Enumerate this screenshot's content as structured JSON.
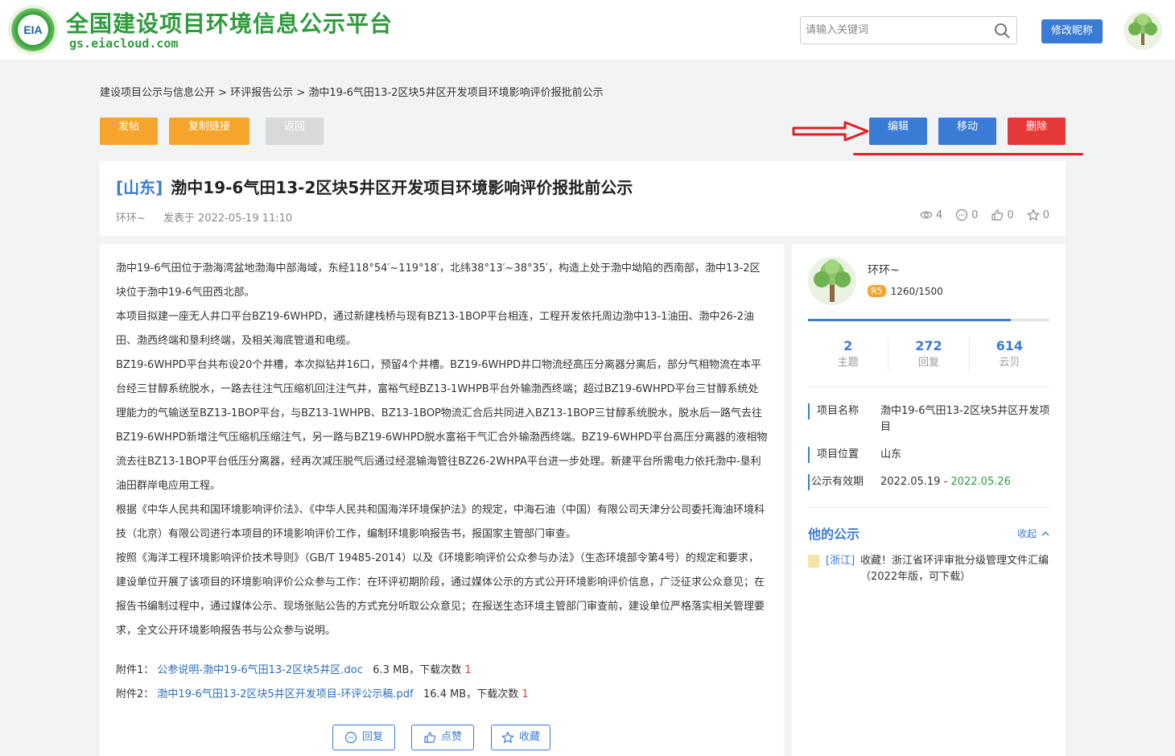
{
  "header": {
    "logo_text": "EIA",
    "site_title": "全国建设项目环境信息公示平台",
    "site_url": "gs.eiacloud.com",
    "search_placeholder": "请输入关键词",
    "nick_button": "修改昵称"
  },
  "breadcrumb": {
    "items": [
      "建设项目公示与信息公开",
      "环评报告公示",
      "渤中19-6气田13-2区块5井区开发项目环境影响评价报批前公示"
    ],
    "separator": ">"
  },
  "toolbar": {
    "post": "发帖",
    "copy_link": "复制链接",
    "back": "返回",
    "edit": "编辑",
    "move": "移动",
    "delete": "删除"
  },
  "post": {
    "region": "[山东]",
    "title": "渤中19-6气田13-2区块5井区开发项目环境影响评价报批前公示",
    "author": "环环~",
    "published": "发表于 2022-05-19 11:10",
    "views": "4",
    "comments": "0",
    "likes": "0",
    "favorites": "0"
  },
  "content": {
    "paragraphs": [
      "渤中19-6气田位于渤海湾盆地渤海中部海域，东经118°54′~119°18′，北纬38°13′~38°35′，构造上处于渤中坳陷的西南部，渤中13-2区块位于渤中19-6气田西北部。",
      "本项目拟建一座无人井口平台BZ19-6WHPD，通过新建栈桥与现有BZ13-1BOP平台相连，工程开发依托周边渤中13-1油田、渤中26-2油田、渤西终端和垦利终端，及相关海底管道和电缆。",
      "BZ19-6WHPD平台共布设20个井槽，本次拟钻井16口，预留4个井槽。BZ19-6WHPD井口物流经高压分离器分离后，部分气相物流在本平台经三甘醇系统脱水，一路去往注气压缩机回注注气井，富裕气经BZ13-1WHPB平台外输渤西终端；超过BZ19-6WHPD平台三甘醇系统处理能力的气输送至BZ13-1BOP平台，与BZ13-1WHPB、BZ13-1BOP物流汇合后共同进入BZ13-1BOP三甘醇系统脱水，脱水后一路气去往BZ19-6WHPD新增注气压缩机压缩注气，另一路与BZ19-6WHPD脱水富裕干气汇合外输渤西终端。BZ19-6WHPD平台高压分离器的液相物流去往BZ13-1BOP平台低压分离器，经再次减压脱气后通过经混输海管往BZ26-2WHPA平台进一步处理。新建平台所需电力依托渤中-垦利油田群岸电应用工程。",
      "根据《中华人民共和国环境影响评价法》、《中华人民共和国海洋环境保护法》的规定，中海石油（中国）有限公司天津分公司委托海油环境科技（北京）有限公司进行本项目的环境影响评价工作，编制环境影响报告书，报国家主管部门审查。",
      "按照《海洋工程环境影响评价技术导则》（GB/T 19485-2014）以及《环境影响评价公众参与办法》（生态环境部令第4号）的规定和要求，建设单位开展了该项目的环境影响评价公众参与工作：在环评初期阶段，通过媒体公示的方式公开环境影响评价信息，广泛征求公众意见；在报告书编制过程中，通过媒体公示、现场张贴公告的方式充分听取公众意见；在报送生态环境主管部门审查前，建设单位严格落实相关管理要求，全文公开环境影响报告书与公众参与说明。"
    ],
    "attachments": [
      {
        "label": "附件1：",
        "name": "公参说明-渤中19-6气田13-2区块5井区.doc",
        "size": "6.3 MB，下载次数",
        "downloads": "1"
      },
      {
        "label": "附件2：",
        "name": "渤中19-6气田13-2区块5井区开发项目-环评公示稿.pdf",
        "size": "16.4 MB，下载次数",
        "downloads": "1"
      }
    ],
    "actions": {
      "reply": "回复",
      "like": "点赞",
      "favorite": "收藏"
    }
  },
  "sidebar": {
    "name": "环环~",
    "level": "R5",
    "points": "1260/1500",
    "progress": 0.84,
    "counts": [
      {
        "n": "2",
        "l": "主题"
      },
      {
        "n": "272",
        "l": "回复"
      },
      {
        "n": "614",
        "l": "云贝"
      }
    ],
    "info": {
      "name_key": "项目名称",
      "name_val": "渤中19-6气田13-2区块5井区开发项目",
      "loc_key": "项目位置",
      "loc_val": "山东",
      "period_key": "公示有效期",
      "period_start": "2022.05.19",
      "period_sep": " - ",
      "period_end": "2022.05.26"
    },
    "his_title": "他的公示",
    "collapse": "收起",
    "his_item": {
      "region": "[浙江]",
      "text": "收藏！浙江省环评审批分级管理文件汇编（2022年版，可下载）"
    }
  },
  "colors": {
    "accent": "#3a7bd5",
    "orange": "#f5a52c",
    "red": "#e53a3a",
    "green": "#2f9b3d"
  }
}
